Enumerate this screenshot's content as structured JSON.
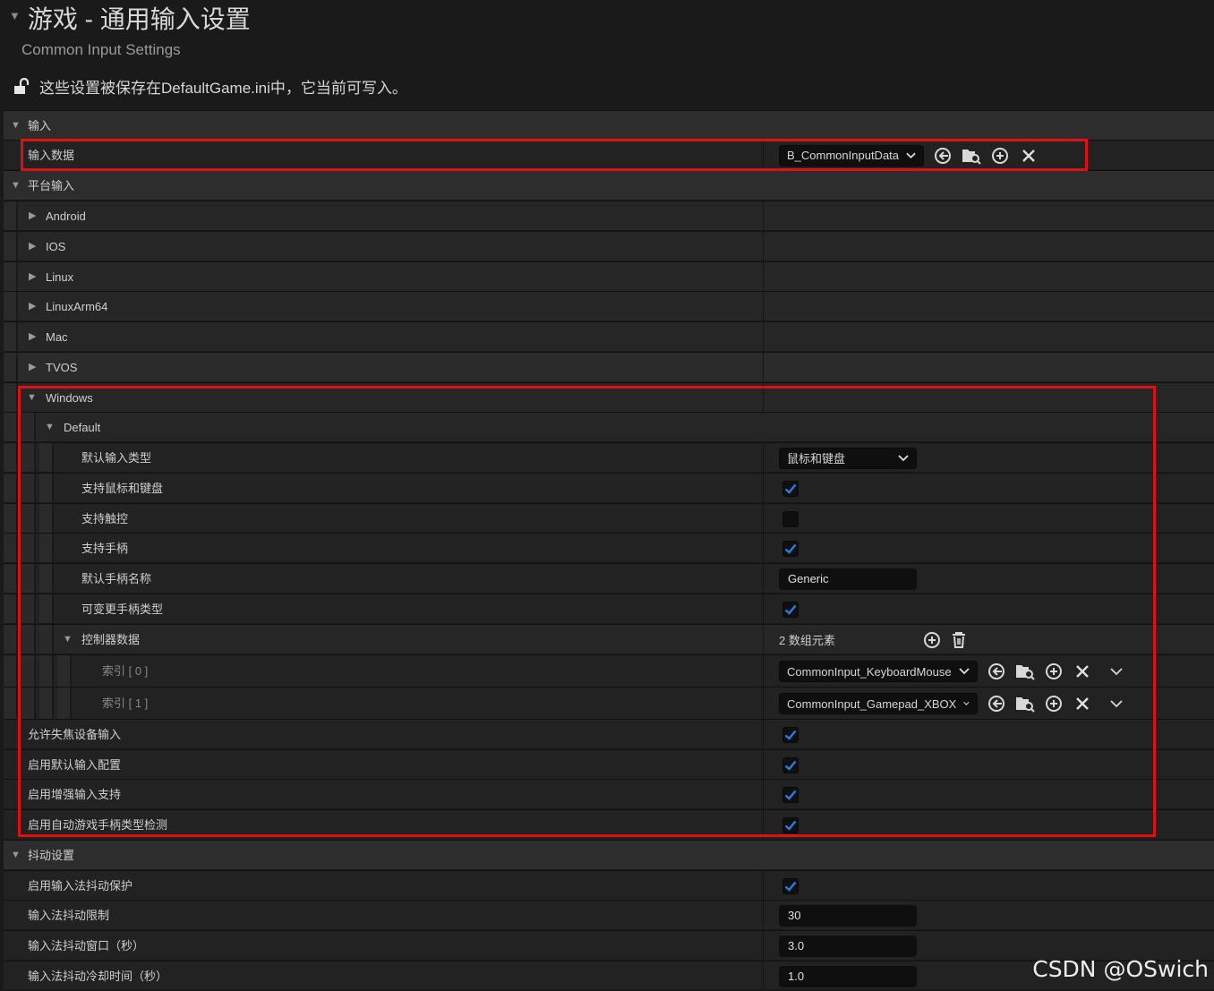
{
  "header": {
    "title": "游戏 - 通用输入设置",
    "subtitle": "Common Input Settings",
    "note": "这些设置被保存在DefaultGame.ini中，它当前可写入。"
  },
  "input_section": {
    "title": "输入",
    "input_data_label": "输入数据",
    "input_data_value": "B_CommonInputData"
  },
  "platform_section": {
    "title": "平台输入",
    "platforms": [
      "Android",
      "IOS",
      "Linux",
      "LinuxArm64",
      "Mac",
      "TVOS"
    ],
    "windows": {
      "label": "Windows",
      "default_label": "Default",
      "default_input_type_label": "默认输入类型",
      "default_input_type_value": "鼠标和键盘",
      "support_mouse_keyboard_label": "支持鼠标和键盘",
      "support_mouse_keyboard": true,
      "support_touch_label": "支持触控",
      "support_touch": false,
      "support_gamepad_label": "支持手柄",
      "support_gamepad": true,
      "default_gamepad_name_label": "默认手柄名称",
      "default_gamepad_name_value": "Generic",
      "can_change_gamepad_type_label": "可变更手柄类型",
      "can_change_gamepad_type": true,
      "controller_data_label": "控制器数据",
      "controller_data_count": "2 数组元素",
      "controller_items": [
        {
          "label": "索引 [ 0 ]",
          "value": "CommonInput_KeyboardMouse"
        },
        {
          "label": "索引 [ 1 ]",
          "value": "CommonInput_Gamepad_XBOX"
        }
      ]
    },
    "allow_unfocused_label": "允许失焦设备输入",
    "allow_unfocused": true,
    "enable_default_config_label": "启用默认输入配置",
    "enable_default_config": true,
    "enable_enhanced_label": "启用增强输入支持",
    "enable_enhanced": true,
    "enable_auto_detect_label": "启用自动游戏手柄类型检测",
    "enable_auto_detect": true
  },
  "jitter_section": {
    "title": "抖动设置",
    "protection_label": "启用输入法抖动保护",
    "protection": true,
    "limit_label": "输入法抖动限制",
    "limit_value": "30",
    "window_label": "输入法抖动窗口（秒）",
    "window_value": "3.0",
    "cooldown_label": "输入法抖动冷却时间（秒）",
    "cooldown_value": "1.0"
  },
  "watermark": "CSDN @OSwich",
  "colors": {
    "accent_check": "#2a7de0",
    "highlight_box": "#e01010",
    "background": "#1a1a1a"
  }
}
